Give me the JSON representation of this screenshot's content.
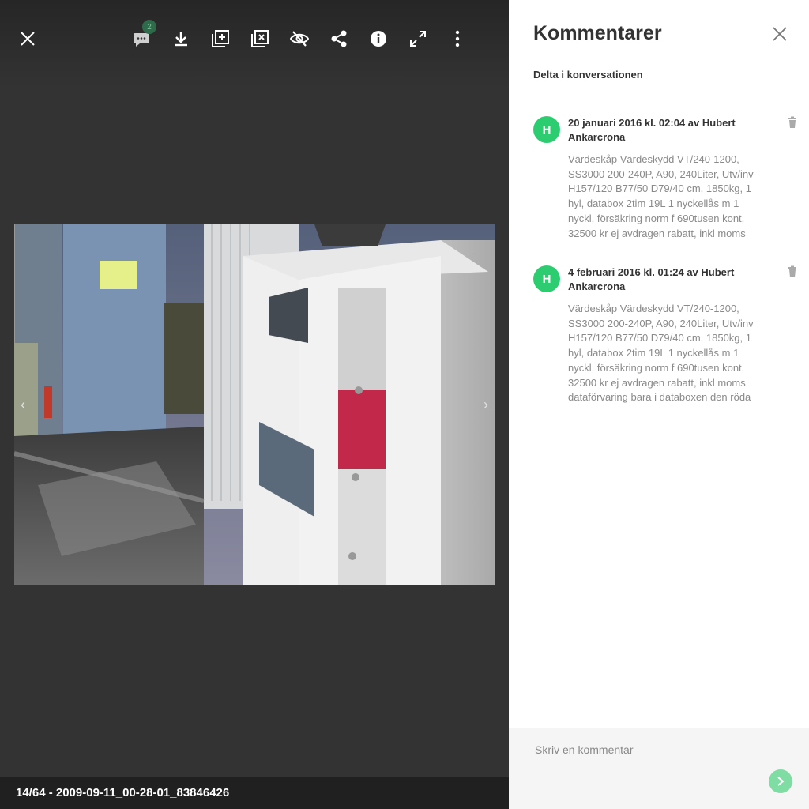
{
  "viewer": {
    "comment_count": "2",
    "footer_text": "14/64 - 2009-09-11_00-28-01_83846426",
    "colors": {
      "background": "#333333",
      "footer": "#202020"
    }
  },
  "toolbar": {
    "icons": [
      "close-icon",
      "comment-icon",
      "download-icon",
      "add-to-collection-icon",
      "remove-from-collection-icon",
      "hide-icon",
      "share-icon",
      "info-icon",
      "fullscreen-icon",
      "more-icon"
    ]
  },
  "panel": {
    "title": "Kommentarer",
    "subtitle": "Delta i konversationen",
    "comments": [
      {
        "avatar": "H",
        "header": "20 januari 2016 kl. 02:04 av Hubert Ankarcrona",
        "body": "Värdeskåp Värdeskydd VT/240-1200, SS3000 200-240P, A90, 240Liter, Utv/inv H157/120 B77/50 D79/40 cm, 1850kg, 1 hyl, databox 2tim 19L 1 nyckellås m 1 nyckl, försäkring norm f 690tusen kont, 32500 kr ej avdragen rabatt, inkl moms"
      },
      {
        "avatar": "H",
        "header": "4 februari 2016 kl. 01:24 av Hubert Ankarcrona",
        "body": "Värdeskåp Värdeskydd VT/240-1200, SS3000 200-240P, A90, 240Liter, Utv/inv H157/120 B77/50 D79/40 cm, 1850kg, 1 hyl, databox 2tim 19L 1 nyckellås m 1 nyckl, försäkring norm f 690tusen kont, 32500 kr ej avdragen rabatt, inkl moms dataförvaring bara i databoxen den röda"
      }
    ],
    "input_placeholder": "Skriv en kommentar",
    "colors": {
      "avatar": "#2ecc71",
      "send": "#7fdca3",
      "input_bg": "#f5f5f5"
    }
  }
}
